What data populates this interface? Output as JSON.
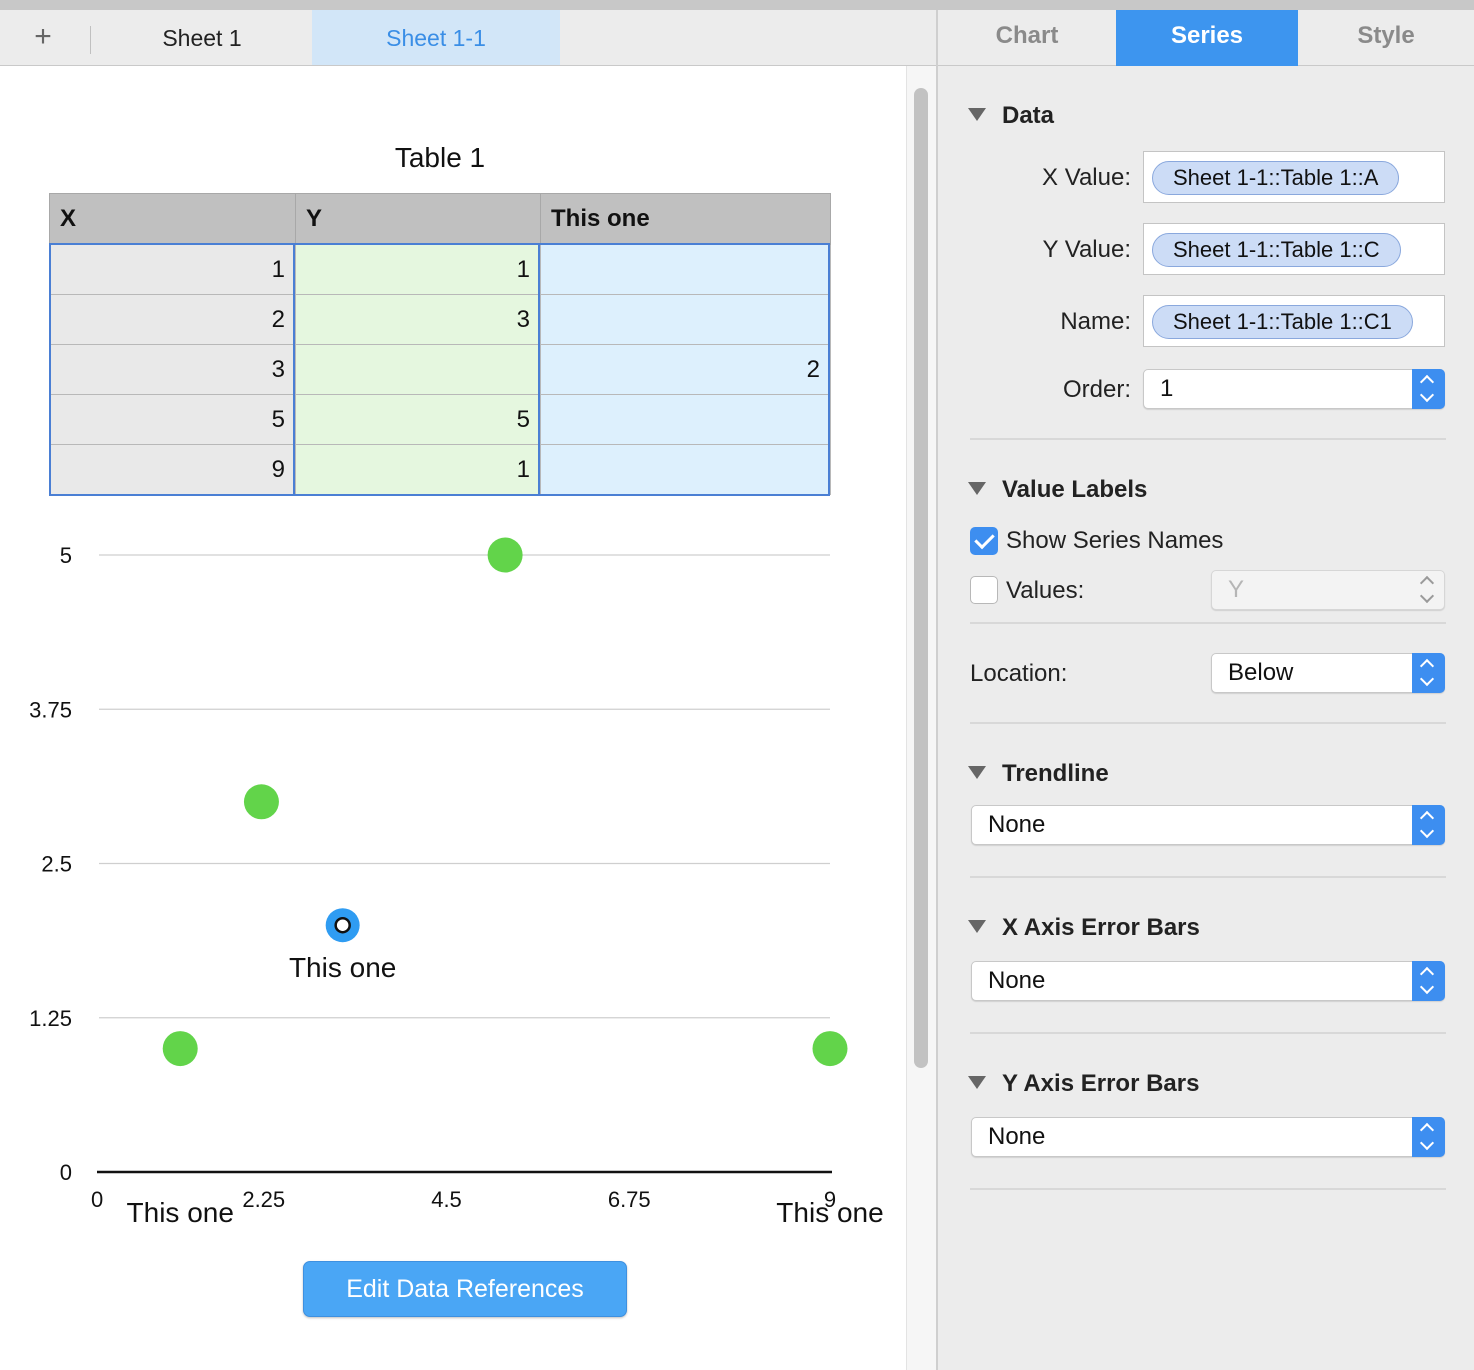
{
  "sheet_tabs": {
    "add_label": "+",
    "tabs": [
      {
        "label": "Sheet 1"
      },
      {
        "label": "Sheet 1-1"
      }
    ]
  },
  "table": {
    "title": "Table 1",
    "headers": [
      "X",
      "Y",
      "This one"
    ],
    "rows": [
      [
        "1",
        "1",
        ""
      ],
      [
        "2",
        "3",
        ""
      ],
      [
        "3",
        "",
        "2"
      ],
      [
        "5",
        "5",
        ""
      ],
      [
        "9",
        "1",
        ""
      ]
    ]
  },
  "chart_data": {
    "type": "scatter",
    "title": "",
    "xlabel": "",
    "ylabel": "",
    "xlim": [
      0,
      9
    ],
    "ylim": [
      0,
      5
    ],
    "x_ticks": [
      "0",
      "2.25",
      "4.5",
      "6.75",
      "9"
    ],
    "y_ticks": [
      "0",
      "1.25",
      "2.5",
      "3.75",
      "5"
    ],
    "grid": true,
    "series": [
      {
        "name": "",
        "color": "#62d44a",
        "points": [
          [
            1,
            1
          ],
          [
            2,
            3
          ],
          [
            5,
            5
          ],
          [
            9,
            1
          ]
        ]
      },
      {
        "name": "This one",
        "color": "#2f9cf2",
        "selected": true,
        "points": [
          [
            3,
            2
          ]
        ]
      }
    ],
    "annotations": [
      {
        "text": "This one",
        "x": 3,
        "y": 2
      },
      {
        "text": "This one",
        "x": 1,
        "y": 0
      },
      {
        "text": "This one",
        "x": 9,
        "y": 0
      }
    ]
  },
  "edit_button": {
    "label": "Edit Data References"
  },
  "panel": {
    "tabs": [
      {
        "label": "Chart"
      },
      {
        "label": "Series"
      },
      {
        "label": "Style"
      }
    ],
    "data_section": {
      "title": "Data",
      "x_value_label": "X Value:",
      "x_value": "Sheet 1-1::Table 1::A",
      "y_value_label": "Y Value:",
      "y_value": "Sheet 1-1::Table 1::C",
      "name_label": "Name:",
      "name_value": "Sheet 1-1::Table 1::C1",
      "order_label": "Order:",
      "order_value": "1"
    },
    "value_labels": {
      "title": "Value Labels",
      "show_series_names": "Show Series Names",
      "values_label": "Values:",
      "values_select": "Y",
      "location_label": "Location:",
      "location_value": "Below"
    },
    "trendline": {
      "title": "Trendline",
      "value": "None"
    },
    "x_error": {
      "title": "X Axis Error Bars",
      "value": "None"
    },
    "y_error": {
      "title": "Y Axis Error Bars",
      "value": "None"
    }
  },
  "colors": {
    "accent": "#3d95ef",
    "series_green": "#62d44a",
    "selection_blue": "#4a7fd4"
  }
}
